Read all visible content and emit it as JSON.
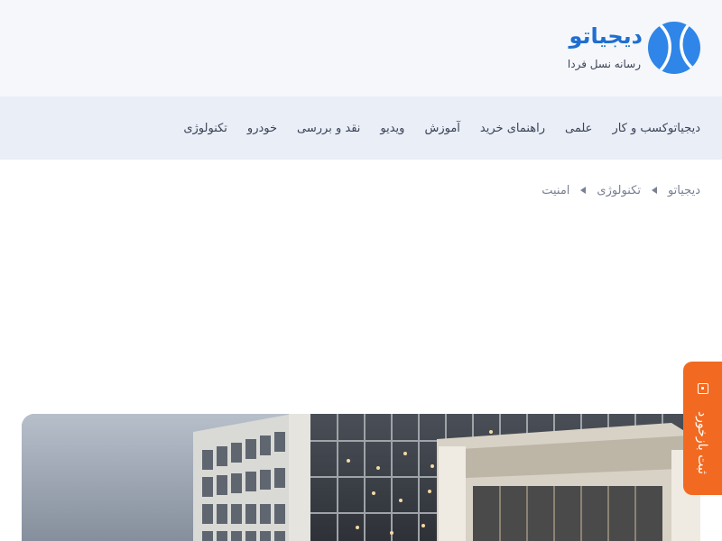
{
  "header": {
    "brand_name": "دیجیاتو",
    "tagline": "رسانه نسل فردا",
    "logo_icon": "tennis-ball-logo",
    "brand_color": "#2f86e8"
  },
  "nav": {
    "items": [
      {
        "label": "تکنولوژی"
      },
      {
        "label": "خودرو"
      },
      {
        "label": "نقد و بررسی"
      },
      {
        "label": "ویدیو"
      },
      {
        "label": "آموزش"
      },
      {
        "label": "راهنمای خرید"
      },
      {
        "label": "علمی"
      },
      {
        "label": "کسب و کار"
      },
      {
        "label": "دیجیاتو"
      }
    ]
  },
  "breadcrumb": {
    "items": [
      {
        "label": "دیجیاتو"
      },
      {
        "label": "تکنولوژی"
      },
      {
        "label": "امنیت"
      }
    ],
    "separator_icon": "caret-left-icon"
  },
  "feedback": {
    "label": "ثبت بازخورد",
    "icon": "feedback-icon",
    "color": "#f26a21"
  }
}
